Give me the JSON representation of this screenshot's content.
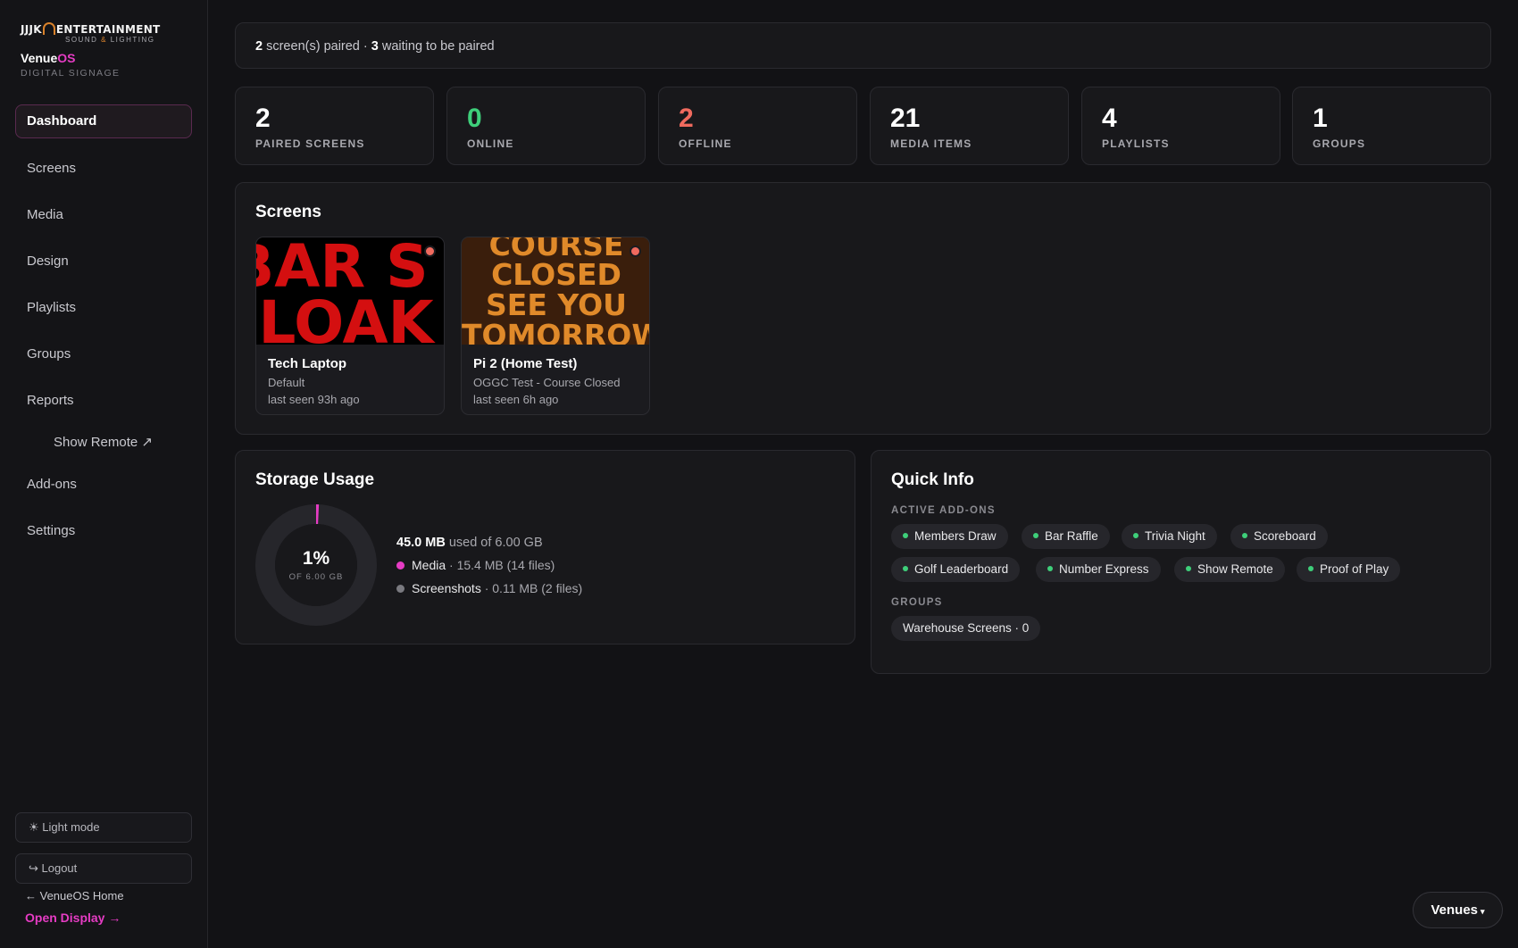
{
  "logo": {
    "line1_left": "JJJK",
    "line1_right": "ENTERTAINMENT",
    "line2_a": "SOUND",
    "line2_amp": "&",
    "line2_b": "LIGHTING"
  },
  "brand": {
    "name": "Venue",
    "os": "OS",
    "subtitle": "DIGITAL SIGNAGE"
  },
  "nav": {
    "items": [
      {
        "label": "Dashboard"
      },
      {
        "label": "Screens"
      },
      {
        "label": "Media"
      },
      {
        "label": "Design"
      },
      {
        "label": "Playlists"
      },
      {
        "label": "Groups"
      },
      {
        "label": "Reports"
      },
      {
        "label": "Show Remote ↗"
      },
      {
        "label": "Add-ons"
      },
      {
        "label": "Settings"
      }
    ]
  },
  "sidebar_footer": {
    "light_mode": "☀ Light mode",
    "logout": "↪ Logout",
    "home": "← VenueOS Home",
    "open_display": "Open Display →"
  },
  "banner": {
    "paired_count": "2",
    "paired_text": " screen(s) paired · ",
    "waiting_count": "3",
    "waiting_text": " waiting to be paired"
  },
  "stats": [
    {
      "value": "2",
      "label": "PAIRED SCREENS",
      "color": "#ffffff"
    },
    {
      "value": "0",
      "label": "ONLINE",
      "color": "#3ecf7a"
    },
    {
      "value": "2",
      "label": "OFFLINE",
      "color": "#f06a5e"
    },
    {
      "value": "21",
      "label": "MEDIA ITEMS",
      "color": "#ffffff"
    },
    {
      "value": "4",
      "label": "PLAYLISTS",
      "color": "#ffffff"
    },
    {
      "value": "1",
      "label": "GROUPS",
      "color": "#ffffff"
    }
  ],
  "screens": {
    "title": "Screens",
    "items": [
      {
        "name": "Tech Laptop",
        "playlist": "Default",
        "last_seen": "last seen 93h ago",
        "status": "offline",
        "thumb_lines": [
          "BAR S",
          "CLOAK"
        ]
      },
      {
        "name": "Pi 2 (Home Test)",
        "playlist": "OGGC Test - Course Closed",
        "last_seen": "last seen 6h ago",
        "status": "offline",
        "thumb_lines": [
          "COURSE",
          "CLOSED",
          "SEE YOU",
          "TOMORROW"
        ]
      }
    ]
  },
  "storage": {
    "title": "Storage Usage",
    "percent": "1%",
    "percent_value": 0.0075,
    "of_label": "OF 6.00 GB",
    "used": "45.0 MB",
    "used_suffix": " used of 6.00 GB",
    "rows": [
      {
        "name": "Media",
        "detail": " · 15.4 MB (14 files)",
        "color": "#e63cc4"
      },
      {
        "name": "Screenshots",
        "detail": " · 0.11 MB (2 files)",
        "color": "#7a7a80"
      }
    ]
  },
  "quick_info": {
    "title": "Quick Info",
    "addons_label": "ACTIVE ADD-ONS",
    "addons": [
      "Members Draw",
      "Bar Raffle",
      "Trivia Night",
      "Scoreboard",
      "Golf Leaderboard",
      "Number Express",
      "Show Remote",
      "Proof of Play"
    ],
    "groups_label": "GROUPS",
    "groups": [
      "Warehouse Screens · 0"
    ]
  },
  "venues_button": {
    "label": "Venues",
    "caret": "▾"
  },
  "colors": {
    "accent": "#e63cc4",
    "online": "#3ecf7a",
    "offline": "#f06a5e",
    "logo_orange": "#d9822b"
  }
}
